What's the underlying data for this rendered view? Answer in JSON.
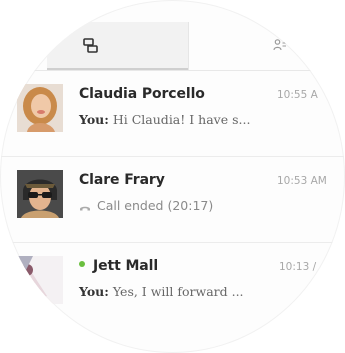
{
  "tabs": [
    {
      "icon": "chats-icon",
      "active": true
    },
    {
      "icon": "contacts-icon",
      "active": false
    }
  ],
  "conversations": [
    {
      "name": "Claudia Porcello",
      "time": "10:55 A",
      "you_prefix": "You:",
      "message": "Hi Claudia! I have s...",
      "avatar": "avatar-claudia",
      "online": false
    },
    {
      "name": "Clare Frary",
      "time": "10:53 AM",
      "call_text": "Call ended (20:17)",
      "call_icon": "phone-icon",
      "avatar": "avatar-clare",
      "online": false
    },
    {
      "name": "Jett Mall",
      "time": "10:13 /",
      "you_prefix": "You:",
      "message": "Yes, I will forward ...",
      "avatar": "avatar-jett",
      "online": true
    }
  ],
  "colors": {
    "online": "#6abf3f",
    "time": "#a8a8a8",
    "active_tab": "#f2f2f2"
  }
}
